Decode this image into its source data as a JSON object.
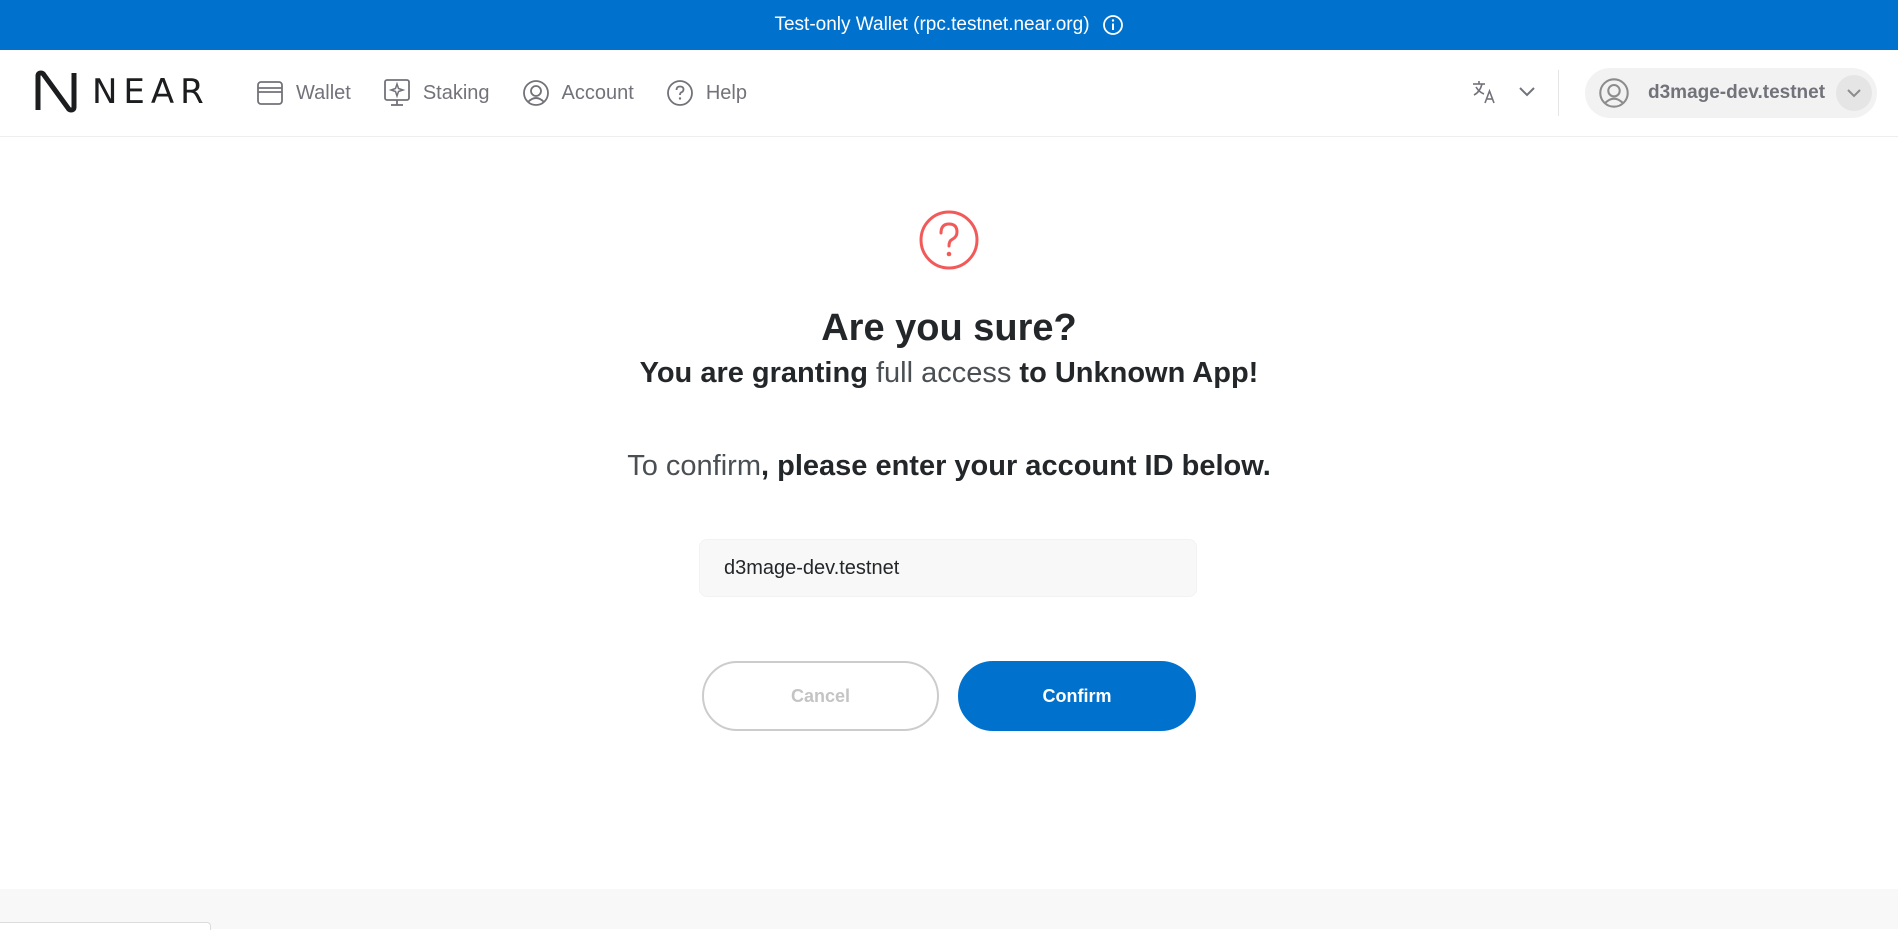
{
  "banner": {
    "text": "Test-only Wallet (rpc.testnet.near.org)",
    "icon": "info-icon"
  },
  "header": {
    "logo_text": "NEAR",
    "nav": [
      {
        "label": "Wallet",
        "icon": "wallet-icon"
      },
      {
        "label": "Staking",
        "icon": "staking-icon"
      },
      {
        "label": "Account",
        "icon": "account-icon"
      },
      {
        "label": "Help",
        "icon": "help-icon"
      }
    ],
    "language_icon": "translate-icon",
    "account_name": "d3mage-dev.testnet"
  },
  "main": {
    "icon": "question-circle-icon",
    "title": "Are you sure?",
    "subtitle_pre": "You are granting ",
    "subtitle_highlight": "full access",
    "subtitle_post": " to Unknown App!",
    "confirm_highlight": "To confirm",
    "confirm_rest": ", please enter your account ID below.",
    "input_value": "d3mage-dev.testnet",
    "cancel_label": "Cancel",
    "confirm_label": "Confirm"
  },
  "colors": {
    "brand_blue": "#0072ce",
    "warning_red": "#f25a5a",
    "nav_text": "#72727a"
  }
}
